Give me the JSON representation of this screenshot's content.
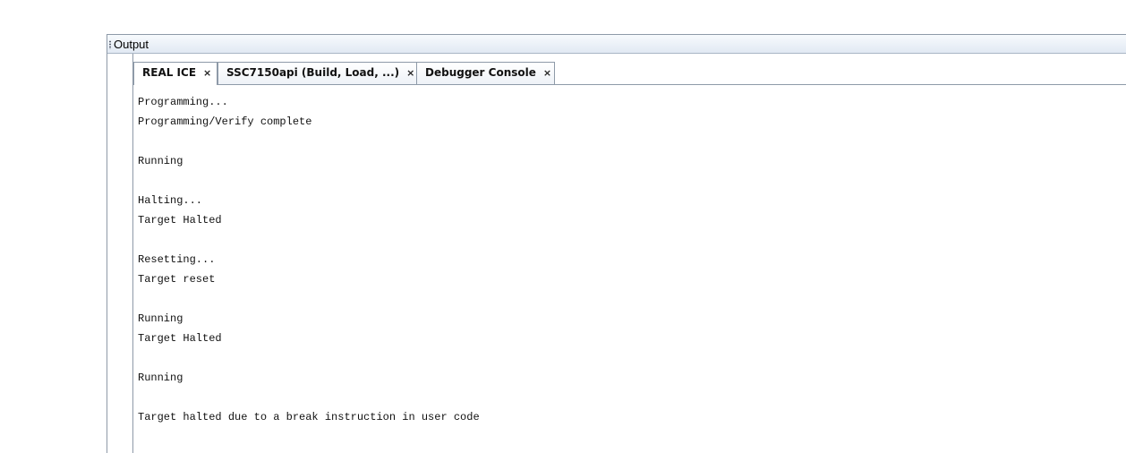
{
  "window": {
    "title": "Output"
  },
  "tabs": [
    {
      "label": "REAL ICE",
      "close": "×",
      "active": true
    },
    {
      "label": "SSC7150api (Build, Load, ...)",
      "close": "×",
      "active": false
    },
    {
      "label": "Debugger Console",
      "close": "×",
      "active": false
    }
  ],
  "console": {
    "lines": [
      "Programming...",
      "Programming/Verify complete",
      "",
      "Running",
      "",
      "Halting...",
      "Target Halted",
      "",
      "Resetting...",
      "Target reset",
      "",
      "Running",
      "Target Halted",
      "",
      "Running",
      "",
      "Target halted due to a break instruction in user code"
    ]
  },
  "colors": {
    "border": "#8e9aa8",
    "title_bar_top": "#f7fafd",
    "title_bar_bottom": "#e1e9f3",
    "text": "#111111"
  }
}
